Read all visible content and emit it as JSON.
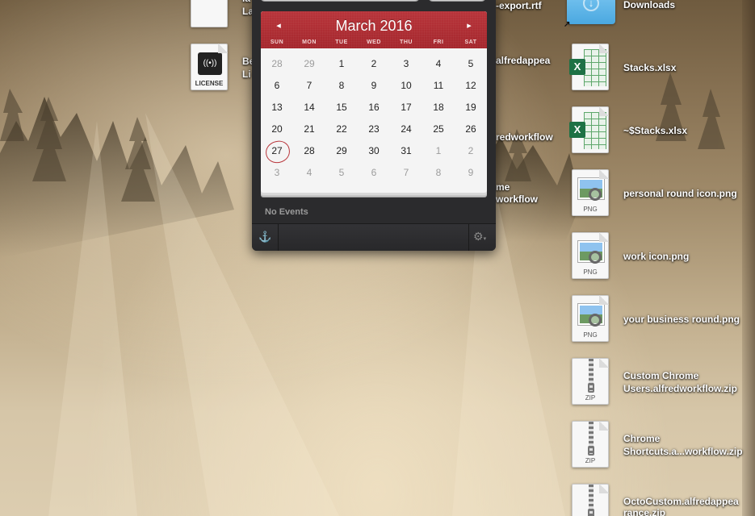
{
  "calendar": {
    "month_title": "March 2016",
    "prev_icon": "◂",
    "next_icon": "▸",
    "weekdays": [
      "SUN",
      "MON",
      "TUE",
      "WED",
      "THU",
      "FRI",
      "SAT"
    ],
    "days": [
      {
        "d": "28",
        "cur": false
      },
      {
        "d": "29",
        "cur": false
      },
      {
        "d": "1",
        "cur": true
      },
      {
        "d": "2",
        "cur": true
      },
      {
        "d": "3",
        "cur": true
      },
      {
        "d": "4",
        "cur": true
      },
      {
        "d": "5",
        "cur": true
      },
      {
        "d": "6",
        "cur": true
      },
      {
        "d": "7",
        "cur": true
      },
      {
        "d": "8",
        "cur": true
      },
      {
        "d": "9",
        "cur": true
      },
      {
        "d": "10",
        "cur": true
      },
      {
        "d": "11",
        "cur": true
      },
      {
        "d": "12",
        "cur": true
      },
      {
        "d": "13",
        "cur": true
      },
      {
        "d": "14",
        "cur": true
      },
      {
        "d": "15",
        "cur": true
      },
      {
        "d": "16",
        "cur": true
      },
      {
        "d": "17",
        "cur": true
      },
      {
        "d": "18",
        "cur": true
      },
      {
        "d": "19",
        "cur": true
      },
      {
        "d": "20",
        "cur": true
      },
      {
        "d": "21",
        "cur": true
      },
      {
        "d": "22",
        "cur": true
      },
      {
        "d": "23",
        "cur": true
      },
      {
        "d": "24",
        "cur": true
      },
      {
        "d": "25",
        "cur": true
      },
      {
        "d": "26",
        "cur": true
      },
      {
        "d": "27",
        "cur": true,
        "today": true
      },
      {
        "d": "28",
        "cur": true
      },
      {
        "d": "29",
        "cur": true
      },
      {
        "d": "30",
        "cur": true
      },
      {
        "d": "31",
        "cur": true
      },
      {
        "d": "1",
        "cur": false
      },
      {
        "d": "2",
        "cur": false
      },
      {
        "d": "3",
        "cur": false
      },
      {
        "d": "4",
        "cur": false
      },
      {
        "d": "5",
        "cur": false
      },
      {
        "d": "6",
        "cur": false
      },
      {
        "d": "7",
        "cur": false
      },
      {
        "d": "8",
        "cur": false
      },
      {
        "d": "9",
        "cur": false
      }
    ],
    "no_events": "No Events",
    "anchor_icon": "⚓",
    "gear_icon": "⚙",
    "gear_caret": "▾",
    "accent_color": "#b1303a"
  },
  "desktop": {
    "left_labels": {
      "top_partial_1": "la",
      "top_partial_2": "La",
      "license_1": "Be",
      "license_2": "Li",
      "license_type": "LICENSE",
      "license_glyph": "((•))"
    },
    "middle_labels": {
      "export": "-export.rtf",
      "alfredappea": "alfredappea",
      "redworkflow": "redworkflow",
      "me": "me",
      "workflow": "workflow"
    },
    "files": [
      {
        "name": "Downloads",
        "kind": "folder",
        "glyph": "↓"
      },
      {
        "name": "Stacks.xlsx",
        "kind": "xlsx",
        "badge": "X"
      },
      {
        "name": "~$Stacks.xlsx",
        "kind": "xlsx",
        "badge": "X"
      },
      {
        "name": "personal round icon.png",
        "kind": "png",
        "type": "PNG"
      },
      {
        "name": "work icon.png",
        "kind": "png",
        "type": "PNG"
      },
      {
        "name": "your business round.png",
        "kind": "png",
        "type": "PNG"
      },
      {
        "name1": "Custom Chrome",
        "name2": "Users.alfredworkflow.zip",
        "kind": "zip",
        "type": "ZIP"
      },
      {
        "name1": "Chrome",
        "name2": "Shortcuts.a...workflow.zip",
        "kind": "zip",
        "type": "ZIP"
      },
      {
        "name1": "OctoCustom.alfredappea",
        "name2": "rance.zip",
        "kind": "zip",
        "type": "ZIP"
      }
    ],
    "alias_glyph": "↗"
  }
}
